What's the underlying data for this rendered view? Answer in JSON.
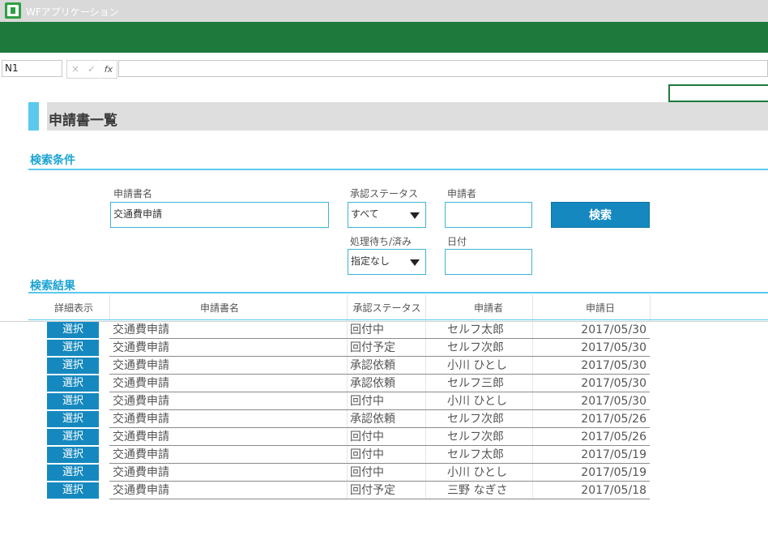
{
  "window": {
    "title": "WFアプリケーション"
  },
  "formula_bar": {
    "cell_ref": "N1",
    "cancel_icon": "×",
    "enter_icon": "✓",
    "fx_label": "fx",
    "value": ""
  },
  "page": {
    "title": "申請書一覧"
  },
  "search": {
    "section_title": "検索条件",
    "form_name_label": "申請書名",
    "form_name_value": "交通費申請",
    "status_label": "承認ステータス",
    "status_value": "すべて",
    "applicant_label": "申請者",
    "applicant_value": "",
    "pending_label": "処理待ち/済み",
    "pending_value": "指定なし",
    "date_label": "日付",
    "date_value": "",
    "search_button": "検索"
  },
  "results": {
    "section_title": "検索結果",
    "columns": [
      "詳細表示",
      "申請書名",
      "承認ステータス",
      "申請者",
      "申請日"
    ],
    "select_label": "選択",
    "rows": [
      {
        "name": "交通費申請",
        "status": "回付中",
        "applicant": "セルフ太郎",
        "date": "2017/05/30"
      },
      {
        "name": "交通費申請",
        "status": "回付予定",
        "applicant": "セルフ次郎",
        "date": "2017/05/30"
      },
      {
        "name": "交通費申請",
        "status": "承認依頼",
        "applicant": "小川 ひとし",
        "date": "2017/05/30"
      },
      {
        "name": "交通費申請",
        "status": "承認依頼",
        "applicant": "セルフ三郎",
        "date": "2017/05/30"
      },
      {
        "name": "交通費申請",
        "status": "回付中",
        "applicant": "小川 ひとし",
        "date": "2017/05/30"
      },
      {
        "name": "交通費申請",
        "status": "承認依頼",
        "applicant": "セルフ次郎",
        "date": "2017/05/26"
      },
      {
        "name": "交通費申請",
        "status": "回付中",
        "applicant": "セルフ次郎",
        "date": "2017/05/26"
      },
      {
        "name": "交通費申請",
        "status": "回付中",
        "applicant": "セルフ太郎",
        "date": "2017/05/19"
      },
      {
        "name": "交通費申請",
        "status": "回付中",
        "applicant": "小川 ひとし",
        "date": "2017/05/19"
      },
      {
        "name": "交通費申請",
        "status": "回付予定",
        "applicant": "三野 なぎさ",
        "date": "2017/05/18"
      }
    ]
  },
  "colors": {
    "ribbon": "#1e7a3c",
    "accent": "#5bc8ee",
    "button": "#1589bf",
    "section_title": "#1aa3d4"
  }
}
